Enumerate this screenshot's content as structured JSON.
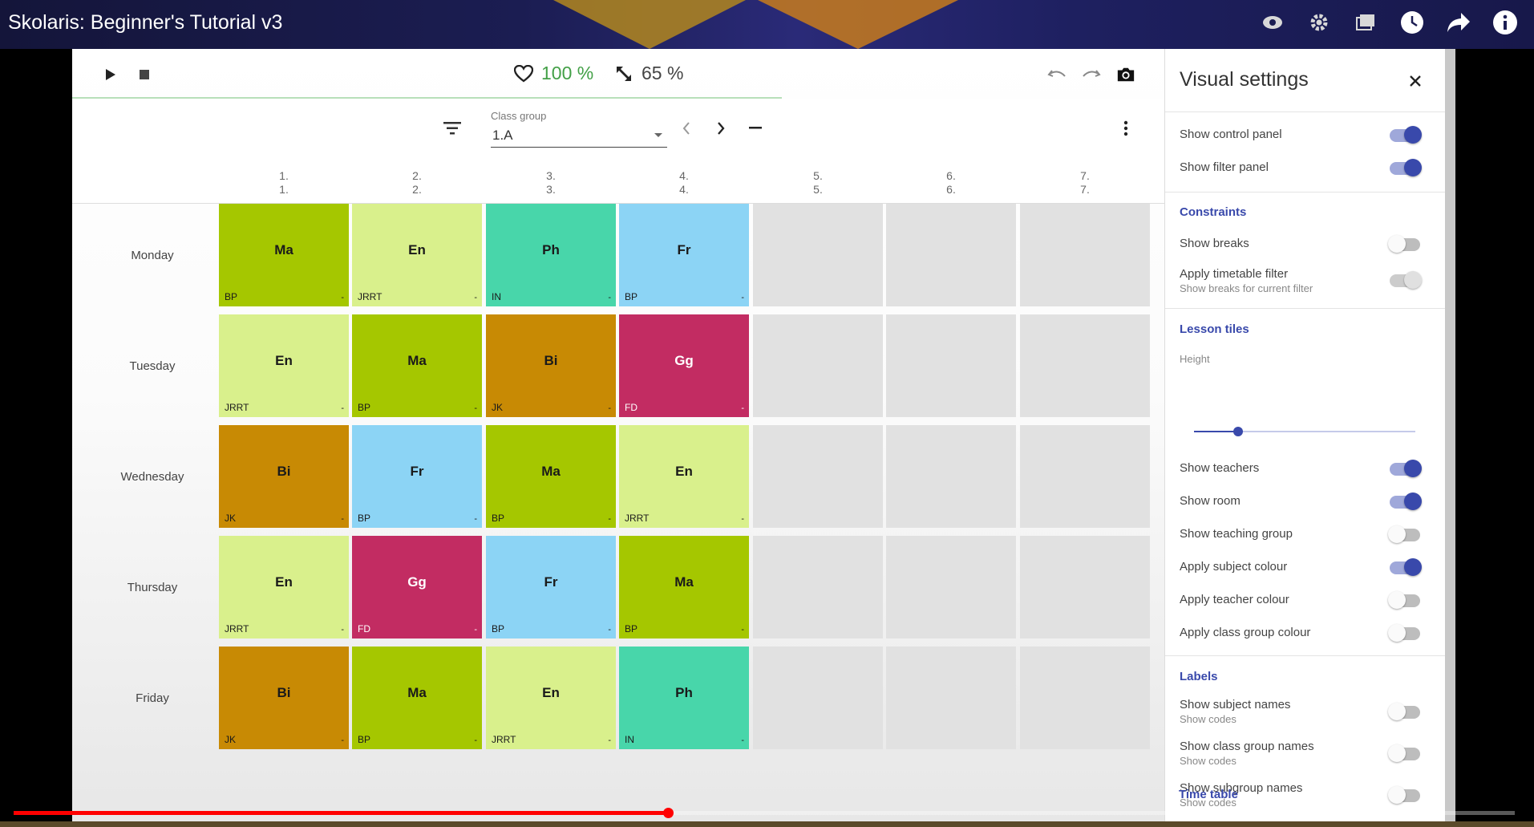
{
  "video": {
    "title": "Skolaris: Beginner's Tutorial v3",
    "progress": 0.436
  },
  "toolbar": {
    "health": "100 %",
    "completion": "65 %"
  },
  "filter": {
    "label": "Class group",
    "value": "1.A"
  },
  "columns": [
    {
      "num": "1.",
      "sub": "1."
    },
    {
      "num": "2.",
      "sub": "2."
    },
    {
      "num": "3.",
      "sub": "3."
    },
    {
      "num": "4.",
      "sub": "4."
    },
    {
      "num": "5.",
      "sub": "5."
    },
    {
      "num": "6.",
      "sub": "6."
    },
    {
      "num": "7.",
      "sub": "7."
    }
  ],
  "days": [
    "Monday",
    "Tuesday",
    "Wednesday",
    "Thursday",
    "Friday"
  ],
  "subject_colors": {
    "Ma": "#a5c700",
    "En": "#d9f08c",
    "Ph": "#48d6aa",
    "Fr": "#8cd4f5",
    "Bi": "#c88a04",
    "Gg": "#c22c62"
  },
  "timetable": [
    [
      {
        "subject": "Ma",
        "teacher": "BP"
      },
      {
        "subject": "En",
        "teacher": "JRRT"
      },
      {
        "subject": "Ph",
        "teacher": "IN"
      },
      {
        "subject": "Fr",
        "teacher": "BP"
      }
    ],
    [
      {
        "subject": "En",
        "teacher": "JRRT"
      },
      {
        "subject": "Ma",
        "teacher": "BP"
      },
      {
        "subject": "Bi",
        "teacher": "JK"
      },
      {
        "subject": "Gg",
        "teacher": "FD"
      }
    ],
    [
      {
        "subject": "Bi",
        "teacher": "JK"
      },
      {
        "subject": "Fr",
        "teacher": "BP"
      },
      {
        "subject": "Ma",
        "teacher": "BP"
      },
      {
        "subject": "En",
        "teacher": "JRRT"
      }
    ],
    [
      {
        "subject": "En",
        "teacher": "JRRT"
      },
      {
        "subject": "Gg",
        "teacher": "FD"
      },
      {
        "subject": "Fr",
        "teacher": "BP"
      },
      {
        "subject": "Ma",
        "teacher": "BP"
      }
    ],
    [
      {
        "subject": "Bi",
        "teacher": "JK"
      },
      {
        "subject": "Ma",
        "teacher": "BP"
      },
      {
        "subject": "En",
        "teacher": "JRRT"
      },
      {
        "subject": "Ph",
        "teacher": "IN"
      }
    ]
  ],
  "tile_dash": "-",
  "panel": {
    "title": "Visual settings",
    "show_control_panel": "Show control panel",
    "show_filter_panel": "Show filter panel",
    "constraints_heading": "Constraints",
    "show_breaks": "Show breaks",
    "apply_timetable_filter": "Apply timetable filter",
    "apply_timetable_filter_sub": "Show breaks for current filter",
    "lesson_tiles_heading": "Lesson tiles",
    "height_label": "Height",
    "height_value": 0.2,
    "show_teachers": "Show teachers",
    "show_room": "Show room",
    "show_teaching_group": "Show teaching group",
    "apply_subject_colour": "Apply subject colour",
    "apply_teacher_colour": "Apply teacher colour",
    "apply_class_group_colour": "Apply class group colour",
    "labels_heading": "Labels",
    "show_subject_names": "Show subject names",
    "show_subject_names_sub": "Show codes",
    "show_class_group_names": "Show class group names",
    "show_class_group_names_sub": "Show codes",
    "show_subgroup_names": "Show subgroup names",
    "show_subgroup_names_sub": "Show codes",
    "time_table_heading": "Time table"
  }
}
